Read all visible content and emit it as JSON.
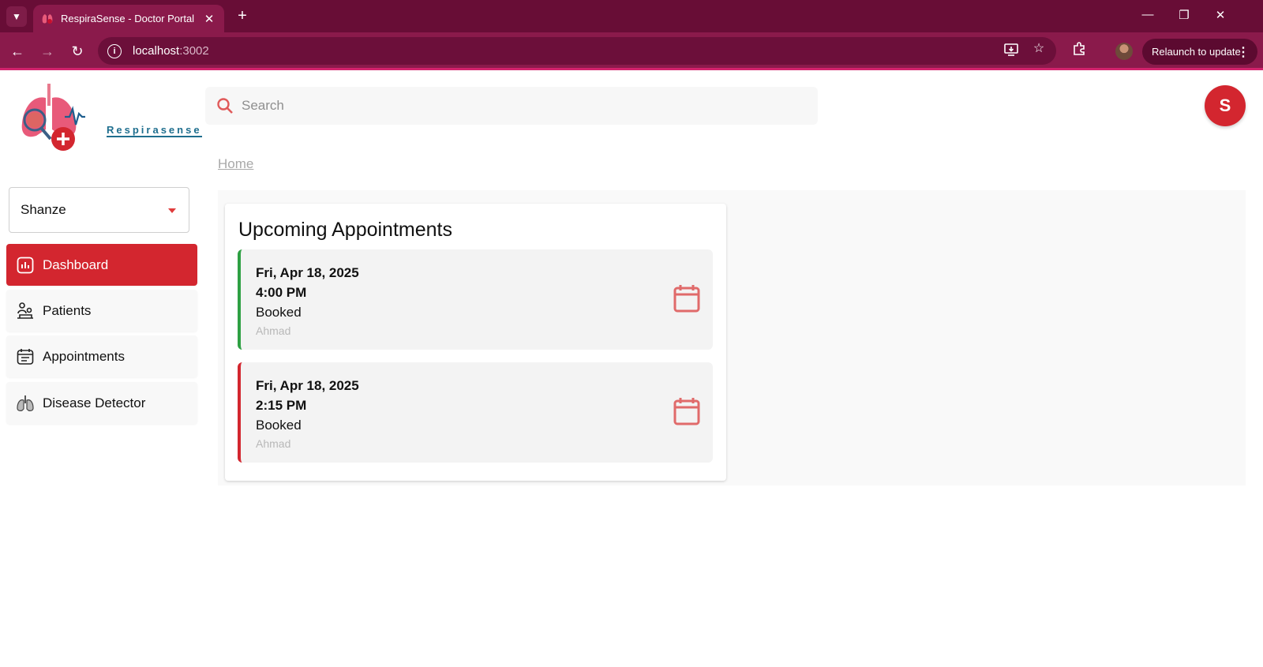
{
  "browser": {
    "tab_title": "RespiraSense - Doctor Portal",
    "url_host": "localhost",
    "url_port": ":3002",
    "relaunch_label": "Relaunch to update"
  },
  "app": {
    "logo_text": "Respirasense",
    "doctor_name": "Shanze",
    "search_placeholder": "Search",
    "user_initial": "S",
    "breadcrumb": "Home",
    "accent_color": "#d3262f"
  },
  "sidebar": {
    "items": [
      {
        "label": "Dashboard",
        "icon": "chart-bars-icon",
        "active": true
      },
      {
        "label": "Patients",
        "icon": "patients-icon",
        "active": false
      },
      {
        "label": "Appointments",
        "icon": "calendar-list-icon",
        "active": false
      },
      {
        "label": "Disease Detector",
        "icon": "lungs-icon",
        "active": false
      }
    ]
  },
  "appointments": {
    "title": "Upcoming Appointments",
    "items": [
      {
        "date": "Fri, Apr 18, 2025",
        "time": "4:00 PM",
        "status": "Booked",
        "patient": "Ahmad",
        "accent": "#2ea043"
      },
      {
        "date": "Fri, Apr 18, 2025",
        "time": "2:15 PM",
        "status": "Booked",
        "patient": "Ahmad",
        "accent": "#d3262f"
      }
    ]
  }
}
